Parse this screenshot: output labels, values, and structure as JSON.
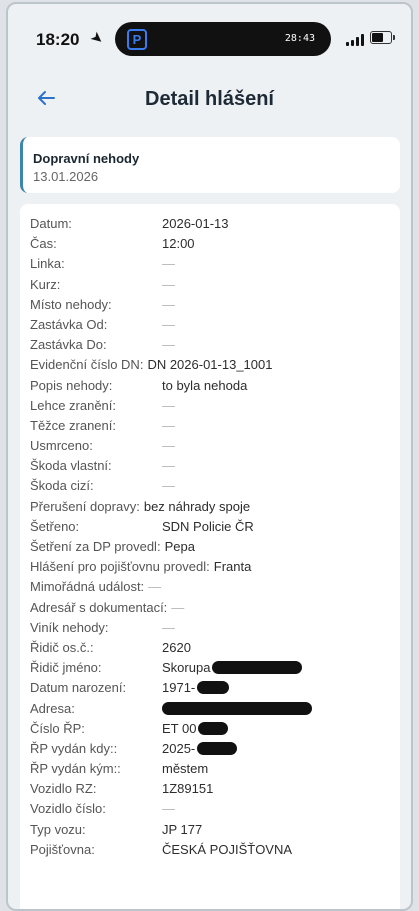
{
  "status_bar": {
    "time": "18:20",
    "location_icon": "location-arrow-icon",
    "island_app_icon_letter": "P",
    "island_timer": "28:43"
  },
  "header": {
    "back_icon": "back-arrow-icon",
    "title": "Detail hlášení"
  },
  "category": {
    "title": "Dopravní nehody",
    "date": "13.01.2026"
  },
  "details": [
    {
      "label": "Datum:",
      "value": "2026-01-13"
    },
    {
      "label": "Čas:",
      "value": "12:00"
    },
    {
      "label": "Linka:",
      "value": "—"
    },
    {
      "label": "Kurz:",
      "value": "—"
    },
    {
      "label": "Místo nehody:",
      "value": "—"
    },
    {
      "label": "Zastávka Od:",
      "value": "—"
    },
    {
      "label": "Zastávka Do:",
      "value": "—"
    },
    {
      "label": "Evidenční číslo DN:",
      "value": "DN 2026-01-13_1001",
      "inline": true
    },
    {
      "label": "Popis nehody:",
      "value": "to byla nehoda"
    },
    {
      "label": "Lehce zranění:",
      "value": "—"
    },
    {
      "label": "Těžce zranení:",
      "value": "—"
    },
    {
      "label": "Usmrceno:",
      "value": "—"
    },
    {
      "label": "Škoda vlastní:",
      "value": "—"
    },
    {
      "label": "Škoda cizí:",
      "value": "—"
    },
    {
      "label": "Přerušení dopravy:",
      "value": "bez náhrady spoje",
      "inline": true
    },
    {
      "label": "Šetřeno:",
      "value": "SDN Policie ČR"
    },
    {
      "label": "Šetření za DP provedl:",
      "value": "Pepa",
      "inline": true
    },
    {
      "label": "Hlášení pro pojišťovnu provedl:",
      "value": "Franta",
      "inline": true
    },
    {
      "label": "Mimořádná událost:",
      "value": "—",
      "inline": true
    },
    {
      "label": "Adresář s dokumentací:",
      "value": "—",
      "inline": true
    },
    {
      "label": "Viník nehody:",
      "value": "—"
    },
    {
      "label": "Řidič os.č.:",
      "value": "2620"
    },
    {
      "label": "Řidič jméno:",
      "value": "Skorupa",
      "redact": 90
    },
    {
      "label": "Datum narození:",
      "value": "1971-",
      "redact": 32
    },
    {
      "label": "Adresa:",
      "value": "",
      "redact": 150
    },
    {
      "label": "Číslo ŘP:",
      "value": "ET 00",
      "redact": 30
    },
    {
      "label": "ŘP vydán kdy::",
      "value": "2025-",
      "redact": 40
    },
    {
      "label": "ŘP vydán kým::",
      "value": "městem"
    },
    {
      "label": "Vozidlo RZ:",
      "value": "1Z89151"
    },
    {
      "label": "Vozidlo číslo:",
      "value": "—"
    },
    {
      "label": "Typ vozu:",
      "value": "JP 177"
    },
    {
      "label": "Pojišťovna:",
      "value": "ČESKÁ POJIŠŤOVNA"
    }
  ]
}
